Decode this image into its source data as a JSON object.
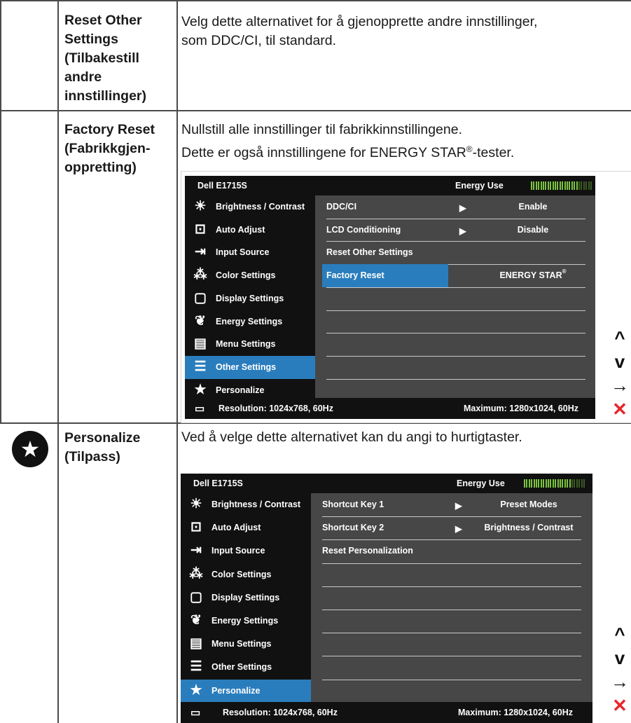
{
  "rows": [
    {
      "name_lines": [
        "Reset Other",
        "Settings",
        "(Tilbakestill",
        "andre",
        "innstillinger)"
      ],
      "desc_lines": [
        "Velg dette alternativet for å gjenopprette andre innstillinger,",
        "som DDC/CI, til standard."
      ]
    },
    {
      "name_lines": [
        "Factory Reset",
        "(Fabrikkgjen-",
        "oppretting)"
      ],
      "desc_line1": "Nullstill alle innstillinger til fabrikkinnstillingene.",
      "desc_line2_pre": "Dette er også innstillingene for ENERGY STAR",
      "desc_line2_sup": "®",
      "desc_line2_post": "-tester."
    },
    {
      "icon": "star-circle-icon",
      "name_lines": [
        "Personalize",
        "(Tilpass)"
      ],
      "desc_line": "Ved å velge dette alternativet kan du angi to hurtigtaster."
    }
  ],
  "menu": [
    {
      "label": "Brightness / Contrast",
      "icon": "brightness-icon"
    },
    {
      "label": "Auto Adjust",
      "icon": "auto-adjust-icon"
    },
    {
      "label": "Input Source",
      "icon": "input-source-icon"
    },
    {
      "label": "Color Settings",
      "icon": "color-settings-icon"
    },
    {
      "label": "Display Settings",
      "icon": "display-settings-icon"
    },
    {
      "label": "Energy Settings",
      "icon": "energy-settings-icon"
    },
    {
      "label": "Menu Settings",
      "icon": "menu-settings-icon"
    },
    {
      "label": "Other Settings",
      "icon": "other-settings-icon"
    },
    {
      "label": "Personalize",
      "icon": "personalize-star-icon"
    }
  ],
  "osd1": {
    "model": "Dell E1715S",
    "energy_label": "Energy Use",
    "energy_level": 0.75,
    "selected_menu": 7,
    "items": [
      {
        "label": "DDC/CI",
        "value": "Enable"
      },
      {
        "label": "LCD Conditioning",
        "value": "Disable"
      },
      {
        "label": "Reset Other Settings",
        "value": ""
      },
      {
        "label": "Factory Reset",
        "value": "ENERGY STAR",
        "value_sup": "®"
      }
    ],
    "selected_item": 3,
    "resolution": "Resolution: 1024x768, 60Hz",
    "maximum": "Maximum: 1280x1024, 60Hz"
  },
  "osd2": {
    "model": "Dell E1715S",
    "energy_label": "Energy Use",
    "energy_level": 0.75,
    "selected_menu": 8,
    "items": [
      {
        "label": "Shortcut Key 1",
        "value": "Preset Modes"
      },
      {
        "label": "Shortcut Key 2",
        "value": "Brightness / Contrast"
      },
      {
        "label": "Reset Personalization",
        "value": ""
      }
    ],
    "resolution": "Resolution: 1024x768, 60Hz",
    "maximum": "Maximum: 1280x1024, 60Hz"
  },
  "nav_buttons": [
    {
      "icon": "up-arrow-icon",
      "glyph": "^",
      "color": "#111111"
    },
    {
      "icon": "down-arrow-icon",
      "glyph": "v",
      "color": "#111111"
    },
    {
      "icon": "right-arrow-icon",
      "glyph": "→",
      "color": "#111111"
    },
    {
      "icon": "close-icon",
      "glyph": "✕",
      "color": "#e8262b"
    }
  ],
  "colors": {
    "highlight": "#2a7dbd",
    "osd_panel": "#474747",
    "osd_bar": "#111111",
    "energy_green": "#7ac43f"
  }
}
